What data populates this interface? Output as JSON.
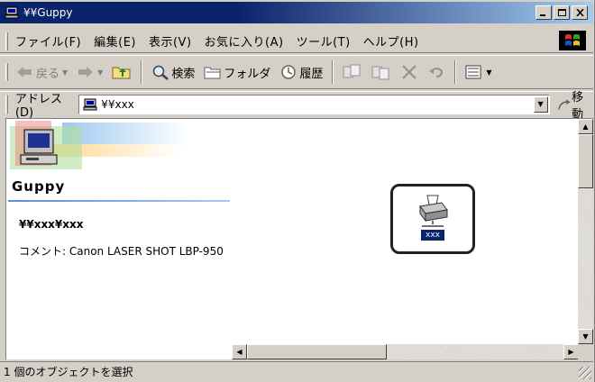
{
  "window": {
    "title": "¥¥Guppy"
  },
  "menu": {
    "items": [
      "ファイル(F)",
      "編集(E)",
      "表示(V)",
      "お気に入り(A)",
      "ツール(T)",
      "ヘルプ(H)"
    ]
  },
  "toolbar": {
    "back_label": "戻る",
    "search_label": "検索",
    "folders_label": "フォルダ",
    "history_label": "履歴"
  },
  "address": {
    "label": "アドレス(D)",
    "value": "¥¥xxx",
    "go_label": "移動"
  },
  "left_pane": {
    "folder_title": "Guppy",
    "path": "¥¥xxx¥xxx",
    "comment": "コメント: Canon LASER SHOT LBP-950"
  },
  "item": {
    "label": "xxx"
  },
  "status": {
    "text": "1 個のオブジェクトを選択"
  }
}
